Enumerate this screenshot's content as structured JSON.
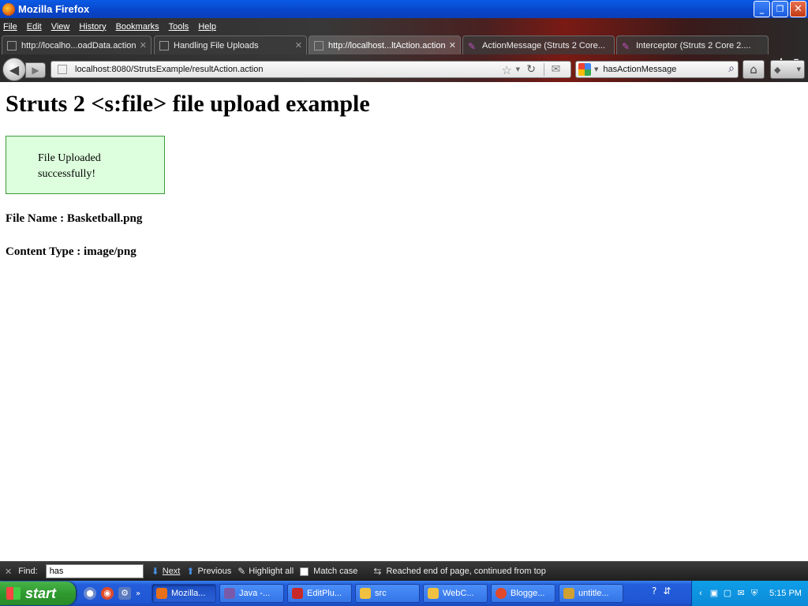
{
  "window": {
    "title": "Mozilla Firefox",
    "controls": {
      "minimize": "_",
      "restore": "❐",
      "close": "✕"
    }
  },
  "menubar": [
    "File",
    "Edit",
    "View",
    "History",
    "Bookmarks",
    "Tools",
    "Help"
  ],
  "tabs": [
    {
      "label": "http://localho...oadData.action",
      "active": false
    },
    {
      "label": "Handling File Uploads",
      "active": false
    },
    {
      "label": "http://localhost...ltAction.action",
      "active": true
    },
    {
      "label": "ActionMessage (Struts 2 Core...",
      "active": false
    },
    {
      "label": "Interceptor (Struts 2 Core 2....",
      "active": false
    }
  ],
  "navbar": {
    "url": "localhost:8080/StrutsExample/resultAction.action",
    "search_query": "hasActionMessage"
  },
  "page": {
    "heading": "Struts 2 <s:file> file upload example",
    "action_message": "File Uploaded successfully!",
    "file_name": "File Name : Basketball.png",
    "content_type": "Content Type : image/png"
  },
  "findbar": {
    "label": "Find:",
    "query": "has",
    "next": "Next",
    "previous": "Previous",
    "highlight_all": "Highlight all",
    "match_case": "Match case",
    "status": "Reached end of page, continued from top"
  },
  "taskbar": {
    "start": "start",
    "tasks": [
      {
        "label": "Mozilla...",
        "icon_color": "#e8701a",
        "active": true
      },
      {
        "label": "Java -...",
        "icon_color": "#7a5aa8",
        "active": false
      },
      {
        "label": "EditPlu...",
        "icon_color": "#c8282a",
        "active": false
      },
      {
        "label": "src",
        "icon_color": "#f0c040",
        "active": false
      },
      {
        "label": "WebC...",
        "icon_color": "#f0c040",
        "active": false
      },
      {
        "label": "Blogge...",
        "icon_color": "#e04a2a",
        "active": false
      },
      {
        "label": "untitle...",
        "icon_color": "#d0a030",
        "active": false
      }
    ],
    "clock": "5:15 PM"
  }
}
